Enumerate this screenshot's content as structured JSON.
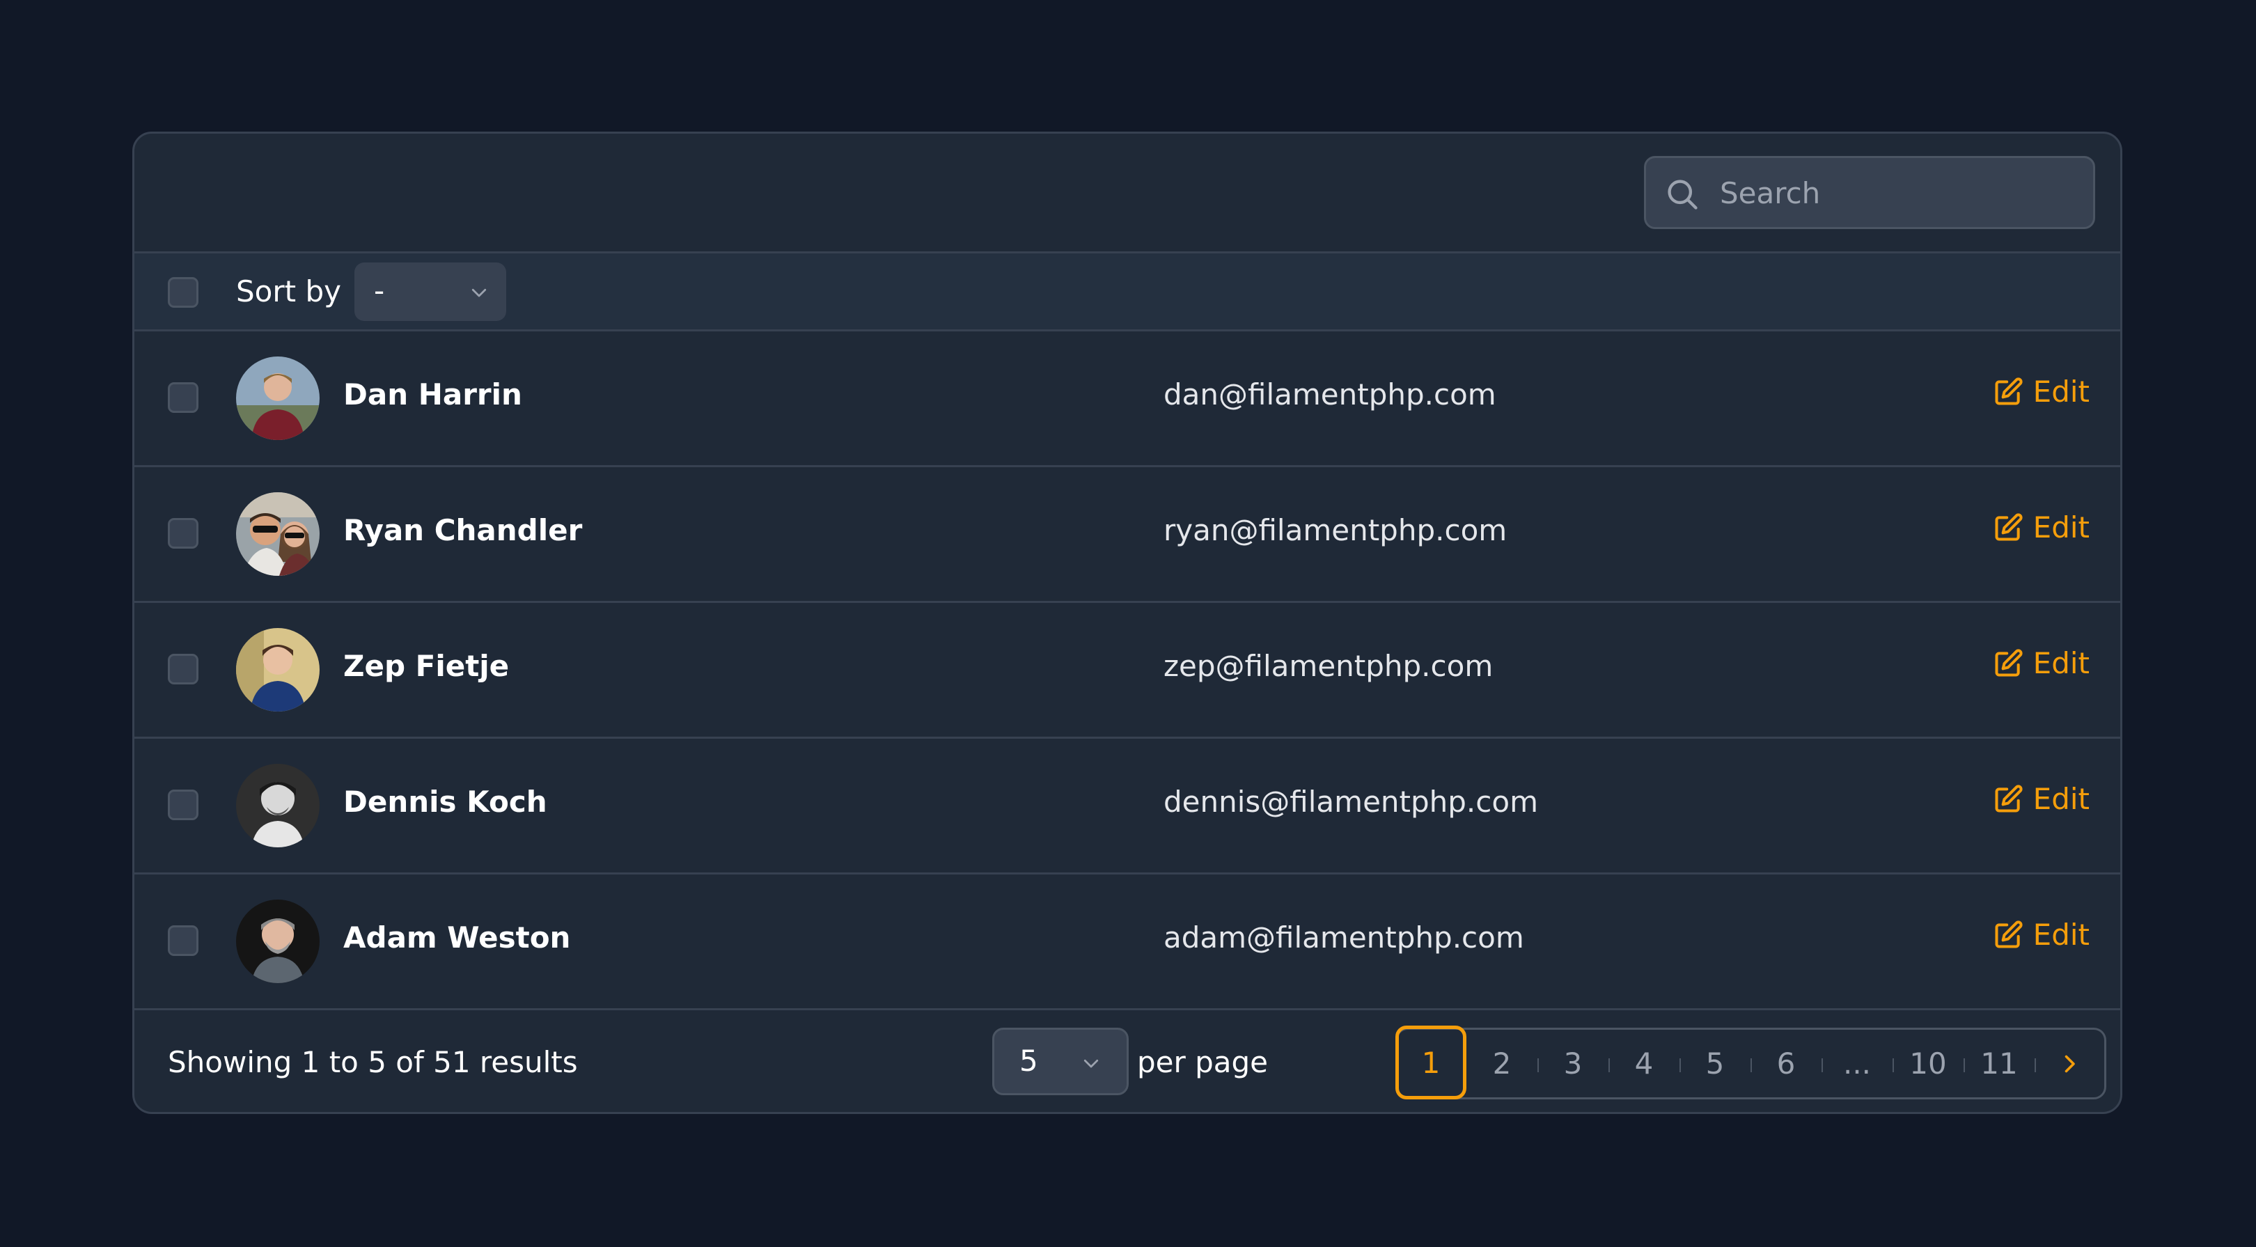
{
  "search": {
    "placeholder": "Search"
  },
  "sort": {
    "label": "Sort by",
    "selected": "-"
  },
  "rows": [
    {
      "name": "Dan Harrin",
      "email": "dan@filamentphp.com",
      "action": "Edit"
    },
    {
      "name": "Ryan Chandler",
      "email": "ryan@filamentphp.com",
      "action": "Edit"
    },
    {
      "name": "Zep Fietje",
      "email": "zep@filamentphp.com",
      "action": "Edit"
    },
    {
      "name": "Dennis Koch",
      "email": "dennis@filamentphp.com",
      "action": "Edit"
    },
    {
      "name": "Adam Weston",
      "email": "adam@filamentphp.com",
      "action": "Edit"
    }
  ],
  "footer": {
    "results_text": "Showing 1 to 5 of 51 results",
    "per_page_value": "5",
    "per_page_label": "per page"
  },
  "pagination": {
    "pages": [
      "1",
      "2",
      "3",
      "4",
      "5",
      "6",
      "...",
      "10",
      "11"
    ],
    "current": "1"
  },
  "colors": {
    "background": "#111827",
    "card": "#1f2937",
    "border": "#374151",
    "accent": "#f59e0b",
    "muted_text": "#9ca3af"
  },
  "icons": {
    "search": "search-icon",
    "sort_chevron": "chevron-down-icon",
    "edit": "edit-icon",
    "next_page": "chevron-right-icon"
  }
}
